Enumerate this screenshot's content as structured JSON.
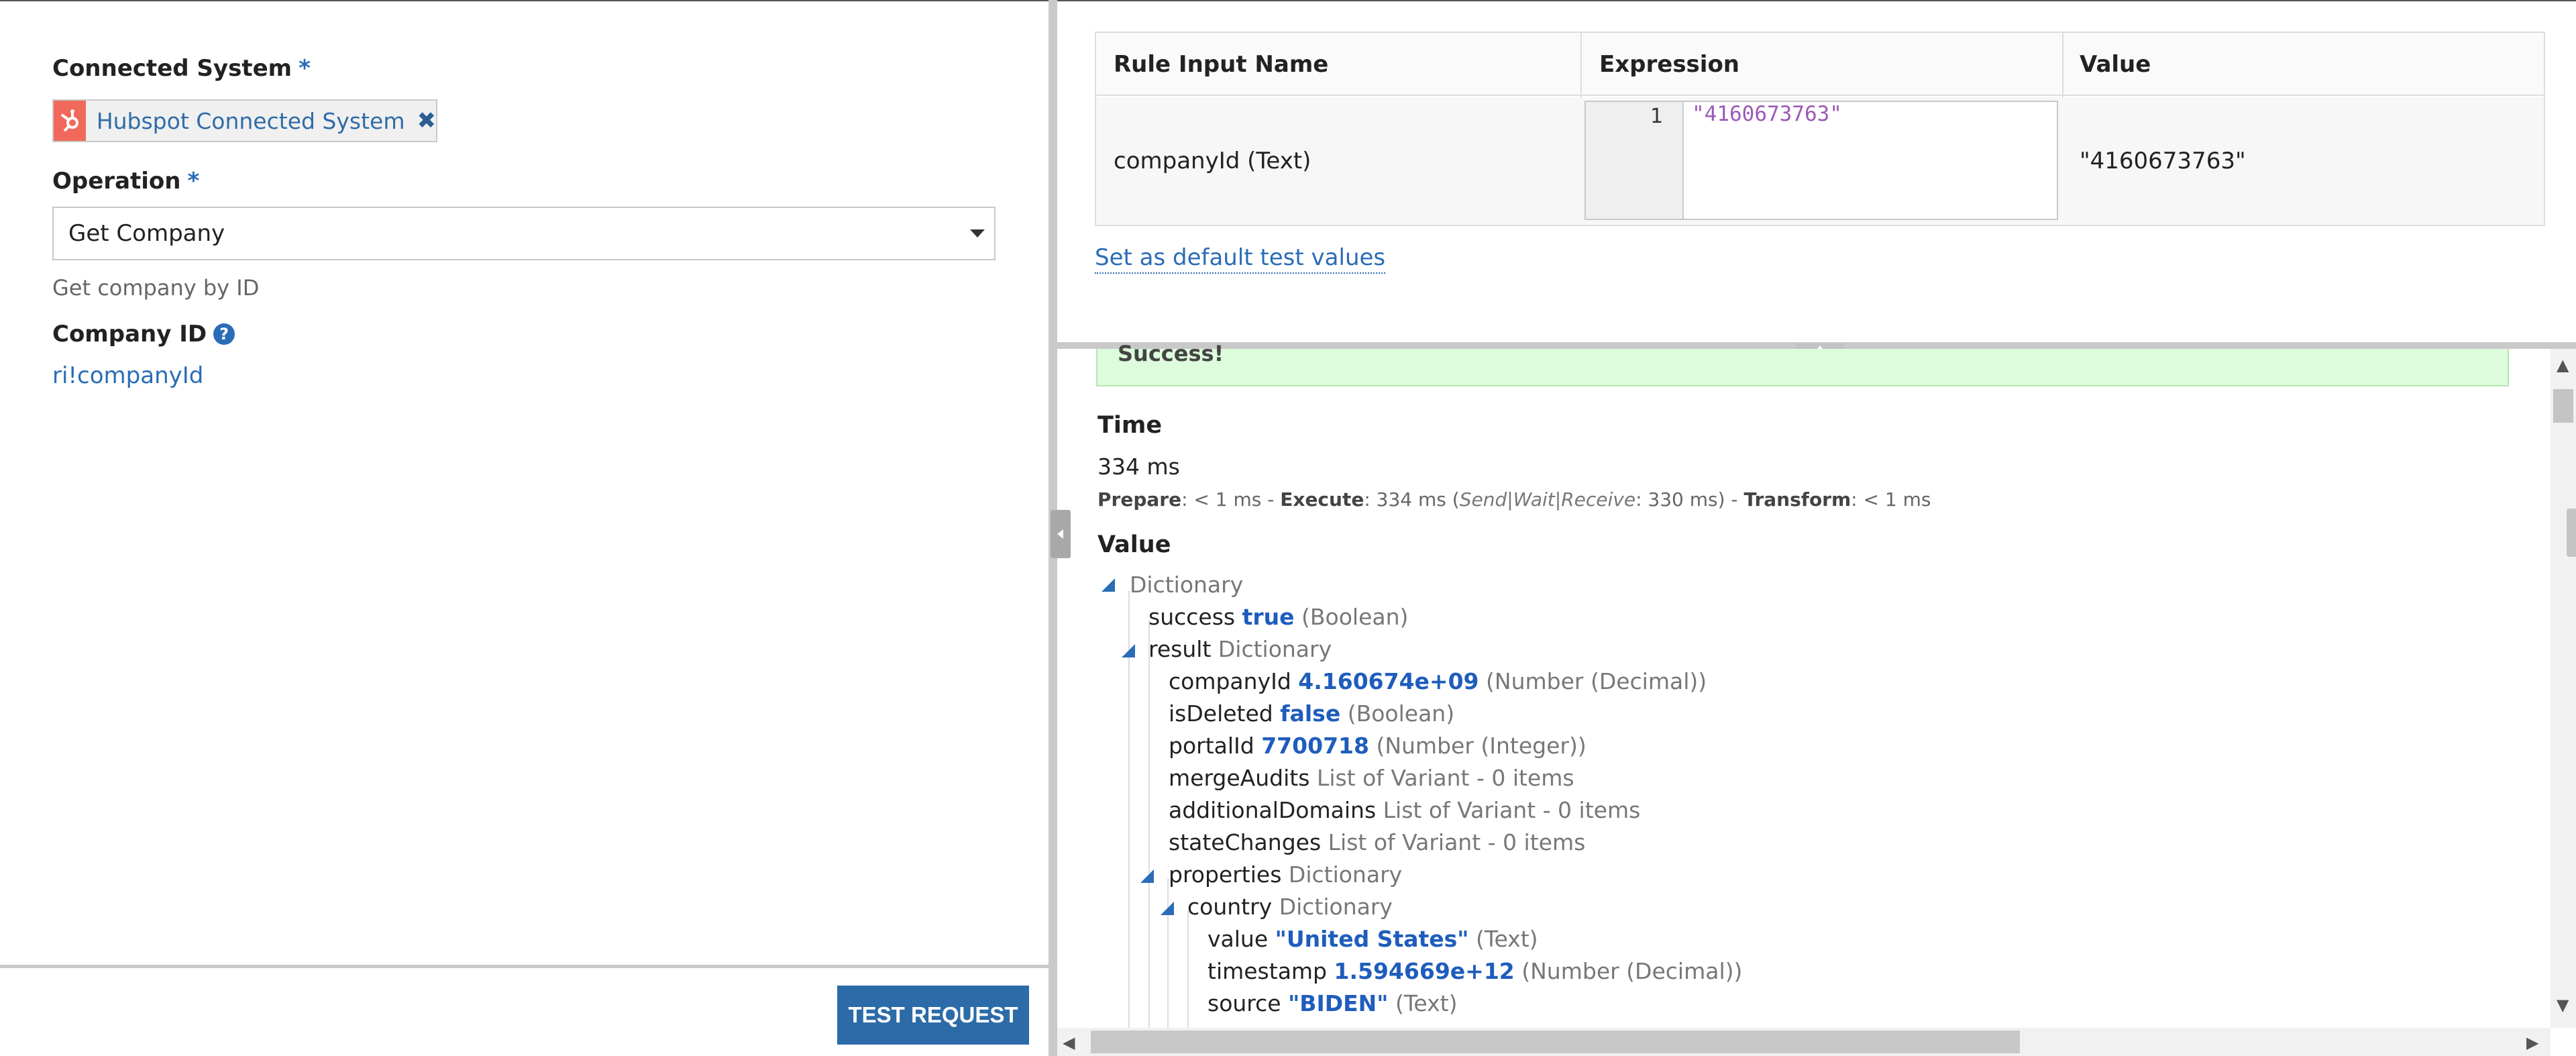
{
  "left_panel": {
    "connected_system": {
      "label": "Connected System",
      "required_mark": "*",
      "selected": "Hubspot Connected System",
      "remove_glyph": "✖"
    },
    "operation": {
      "label": "Operation",
      "required_mark": "*",
      "selected": "Get Company",
      "description": "Get company by ID"
    },
    "company_id": {
      "label": "Company ID",
      "help_glyph": "?",
      "value": "ri!companyId"
    },
    "test_button_label": "TEST REQUEST"
  },
  "rule_inputs": {
    "headers": [
      "Rule Input Name",
      "Expression",
      "Value"
    ],
    "rows": [
      {
        "name": "companyId (Text)",
        "line_number": "1",
        "expression": "\"4160673763\"",
        "value": "\"4160673763\""
      }
    ],
    "default_link": "Set as default test values"
  },
  "result": {
    "status": "Success!",
    "time_title": "Time",
    "time_value": "334 ms",
    "breakdown": {
      "prepare_label": "Prepare",
      "prepare_value": ": < 1 ms - ",
      "execute_label": "Execute",
      "execute_value": ": 334 ms (",
      "phases": "Send|Wait|Receive",
      "phases_value": ": 330 ms) - ",
      "transform_label": "Transform",
      "transform_value": ": < 1 ms"
    },
    "value_title": "Value",
    "tree": [
      {
        "key": "",
        "value": "",
        "type": "Dictionary",
        "depth": 0,
        "expanded": true
      },
      {
        "key": "success",
        "value": "true",
        "type": "(Boolean)",
        "depth": 1
      },
      {
        "key": "result",
        "value": "",
        "type": "Dictionary",
        "depth": 1,
        "expanded": true
      },
      {
        "key": "companyId",
        "value": "4.160674e+09",
        "type": "(Number (Decimal))",
        "depth": 2
      },
      {
        "key": "isDeleted",
        "value": "false",
        "type": "(Boolean)",
        "depth": 2
      },
      {
        "key": "portalId",
        "value": "7700718",
        "type": "(Number (Integer))",
        "depth": 2
      },
      {
        "key": "mergeAudits",
        "value": "",
        "type": "List of Variant - 0 items",
        "depth": 2
      },
      {
        "key": "additionalDomains",
        "value": "",
        "type": "List of Variant - 0 items",
        "depth": 2
      },
      {
        "key": "stateChanges",
        "value": "",
        "type": "List of Variant - 0 items",
        "depth": 2
      },
      {
        "key": "properties",
        "value": "",
        "type": "Dictionary",
        "depth": 2,
        "expanded": true
      },
      {
        "key": "country",
        "value": "",
        "type": "Dictionary",
        "depth": 3,
        "expanded": true
      },
      {
        "key": "value",
        "value": "\"United States\"",
        "type": "(Text)",
        "depth": 4
      },
      {
        "key": "timestamp",
        "value": "1.594669e+12",
        "type": "(Number (Decimal))",
        "depth": 4
      },
      {
        "key": "source",
        "value": "\"BIDEN\"",
        "type": "(Text)",
        "depth": 4
      }
    ]
  },
  "colors": {
    "accent": "#2a6cb6",
    "button": "#2c6ba8",
    "success_bg": "#ddfcdb",
    "tree_value": "#1f5dbc",
    "code_string": "#9b59b6",
    "hubspot": "#f0695a"
  },
  "icons": [
    "hubspot-logo-icon",
    "remove-icon",
    "chevron-down-icon",
    "help-icon",
    "collapse-left-icon",
    "expand-up-icon",
    "tree-expanded-icon",
    "scroll-up-icon",
    "scroll-down-icon",
    "scroll-left-icon",
    "scroll-right-icon"
  ]
}
